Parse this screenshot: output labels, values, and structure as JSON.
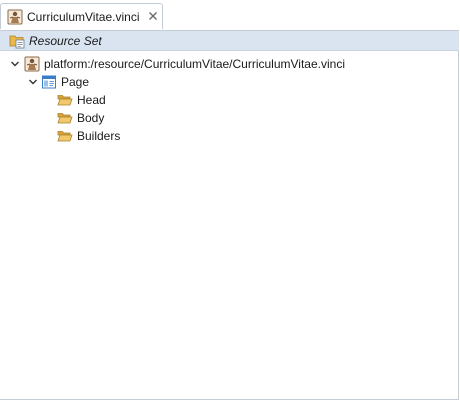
{
  "editor_tab": {
    "title": "CurriculumVitae.vinci",
    "icon": "vinci-file-icon",
    "close_icon": "close-icon"
  },
  "header": {
    "title": "Resource Set",
    "icon": "resource-set-icon"
  },
  "tree": {
    "root": {
      "label": "platform:/resource/CurriculumVitae/CurriculumVitae.vinci",
      "icon": "vinci-file-icon",
      "expanded": true
    },
    "page": {
      "label": "Page",
      "icon": "page-icon",
      "expanded": true
    },
    "children": [
      {
        "label": "Head",
        "icon": "folder-open-icon"
      },
      {
        "label": "Body",
        "icon": "folder-open-icon"
      },
      {
        "label": "Builders",
        "icon": "folder-open-icon"
      }
    ]
  },
  "colors": {
    "header_bg": "#d9e4f0",
    "tab_border": "#c2cbd6",
    "folder": "#e8b84a",
    "page_icon": "#3a7cc7"
  }
}
